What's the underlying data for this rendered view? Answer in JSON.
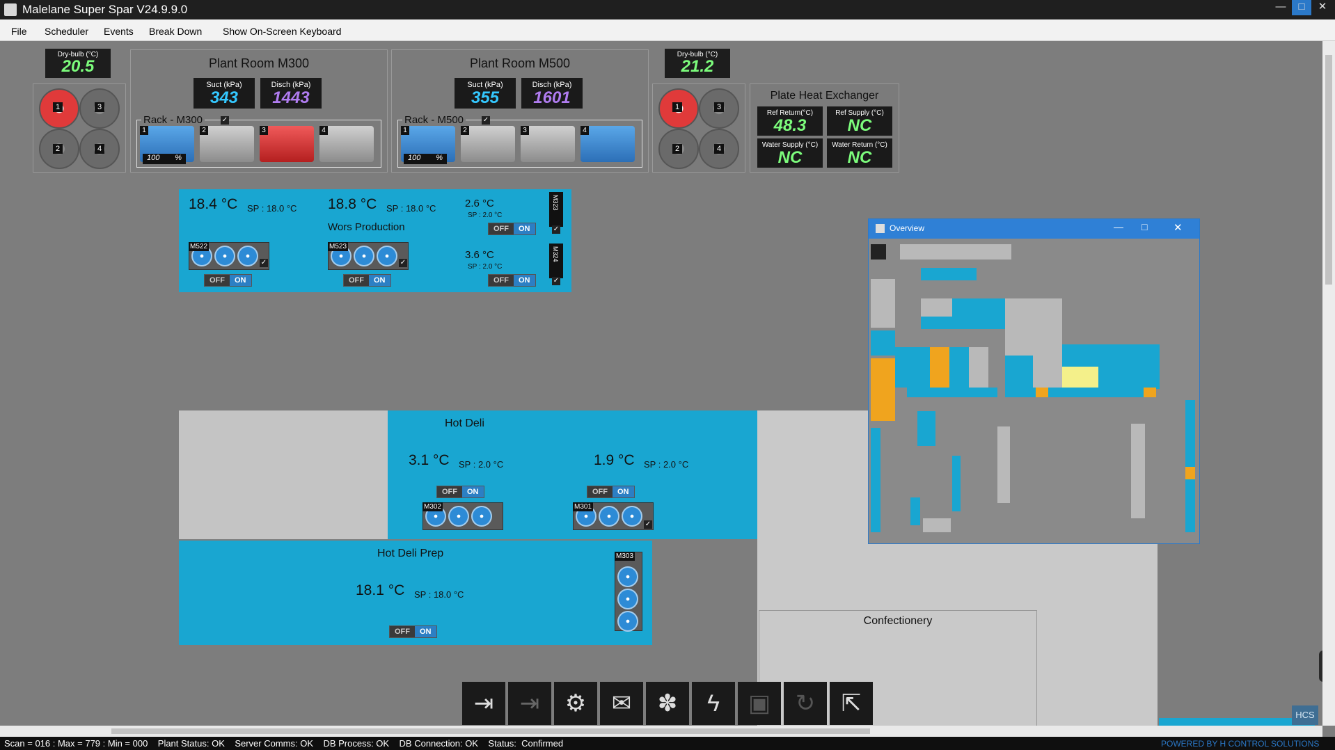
{
  "window": {
    "title": "Malelane Super Spar V24.9.9.0",
    "buttons": [
      "—",
      "□",
      "✕"
    ]
  },
  "menu": [
    "File",
    "Scheduler",
    "Events",
    "Break Down",
    "Show On-Screen Keyboard"
  ],
  "drybulb_left": {
    "label": "Dry-bulb (°C)",
    "value": "20.5"
  },
  "drybulb_right": {
    "label": "Dry-bulb (°C)",
    "value": "21.2"
  },
  "condenser_left": {
    "fans": [
      "1",
      "3",
      "2",
      "4"
    ]
  },
  "condenser_right": {
    "fans": [
      "1",
      "3",
      "2",
      "4"
    ]
  },
  "plant_m300": {
    "title": "Plant Room M300",
    "suct_label": "Suct (kPa)",
    "suct_value": "343",
    "disch_label": "Disch (kPa)",
    "disch_value": "1443",
    "rack_label": "Rack - M300",
    "compressors": [
      "1",
      "2",
      "3",
      "4"
    ],
    "capacity_value": "100",
    "capacity_unit": "%"
  },
  "plant_m500": {
    "title": "Plant Room M500",
    "suct_label": "Suct (kPa)",
    "suct_value": "355",
    "disch_label": "Disch (kPa)",
    "disch_value": "1601",
    "rack_label": "Rack - M500",
    "compressors": [
      "1",
      "2",
      "3",
      "4"
    ],
    "capacity_value": "100",
    "capacity_unit": "%"
  },
  "phe": {
    "title": "Plate Heat Exchanger",
    "ref_return_label": "Ref Return(°C)",
    "ref_return_value": "48.3",
    "ref_supply_label": "Ref Supply (°C)",
    "ref_supply_value": "NC",
    "water_supply_label": "Water Supply (°C)",
    "water_supply_value": "NC",
    "water_return_label": "Water Return (°C)",
    "water_return_value": "NC"
  },
  "wors": {
    "temp1": "18.4 °C",
    "sp1": "SP : 18.0 °C",
    "temp2": "18.8 °C",
    "sp2": "SP : 18.0 °C",
    "title": "Wors Production",
    "unit1": "M522",
    "unit2": "M523",
    "temp3": "2.6 °C",
    "sp3": "SP : 2.0 °C",
    "unit3": "M323",
    "temp4": "3.6 °C",
    "sp4": "SP : 2.0 °C",
    "unit4": "M324"
  },
  "toggle": {
    "off": "OFF",
    "on": "ON"
  },
  "hotdeli": {
    "title": "Hot Deli",
    "temp1": "3.1 °C",
    "sp1": "SP : 2.0 °C",
    "temp2": "1.9 °C",
    "sp2": "SP : 2.0 °C",
    "unit1": "M302",
    "unit2": "M301"
  },
  "hotdeliprep": {
    "title": "Hot Deli Prep",
    "temp": "18.1 °C",
    "sp": "SP : 18.0 °C",
    "unit": "M303"
  },
  "confectionery": {
    "title": "Confectionery"
  },
  "overview": {
    "title": "Overview"
  },
  "toolbar": [
    "login-icon",
    "logout-icon",
    "user-settings-icon",
    "mail-icon",
    "alarm-icon",
    "power-icon",
    "save-icon",
    "refresh-icon",
    "popout-icon"
  ],
  "status": {
    "text": "Scan = 016 : Max = 779 : Min = 000    Plant Status: OK    Server Comms: OK    DB Process: OK    DB Connection: OK    Status:  Confirmed",
    "powered": "POWERED BY H CONTROL SOLUTIONS"
  },
  "logo": "HCS",
  "colors": {
    "zone": "#19a6d1",
    "green_value": "#7cfc7c",
    "cyan_value": "#34c8ff",
    "purple_value": "#b07cf0"
  }
}
